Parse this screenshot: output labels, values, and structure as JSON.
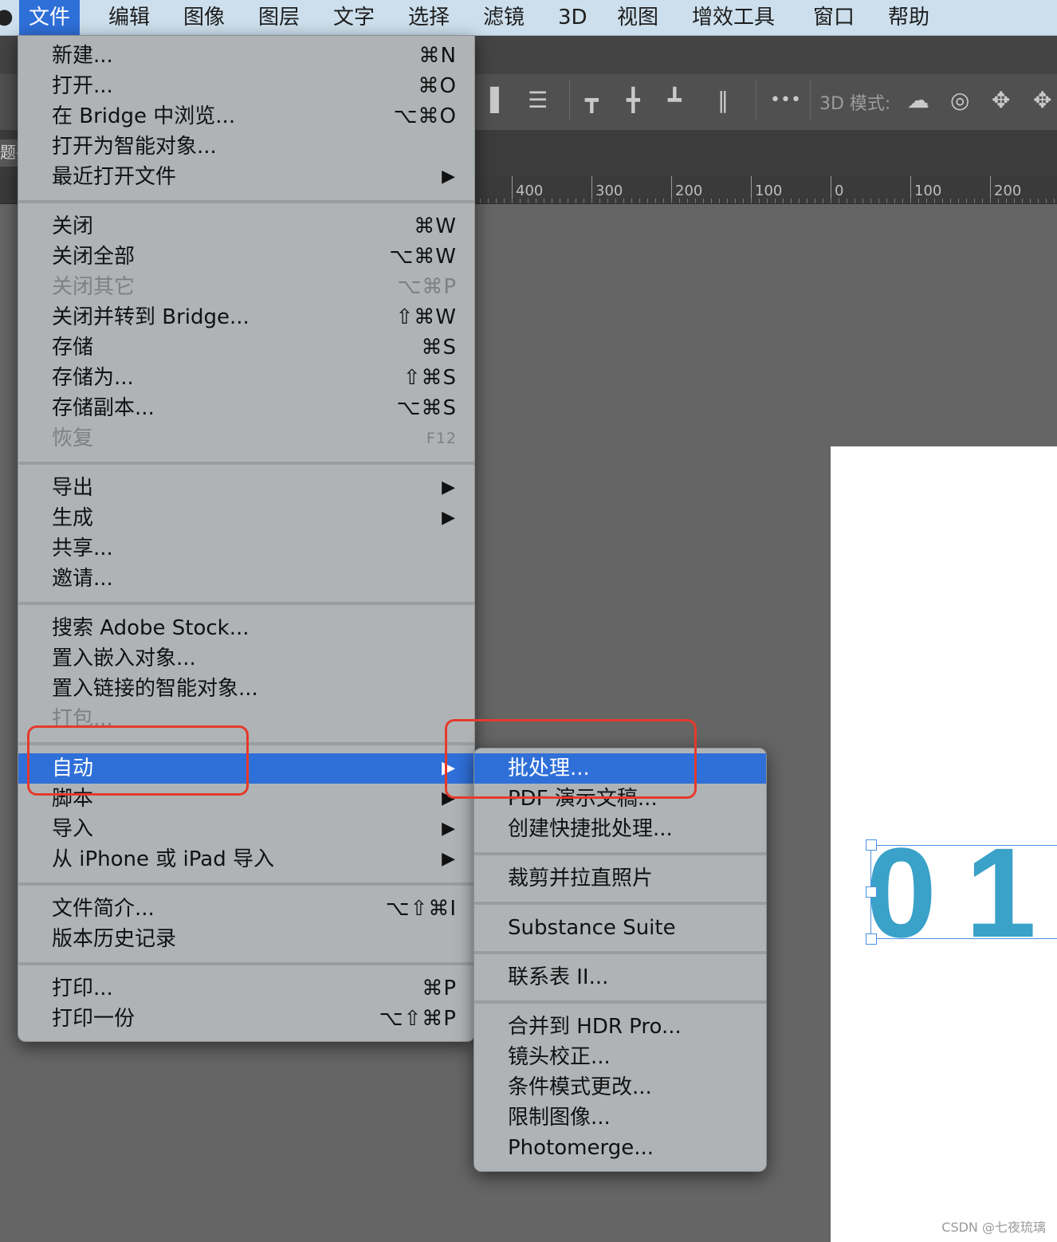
{
  "menubar": {
    "items": [
      "文件",
      "编辑",
      "图像",
      "图层",
      "文字",
      "选择",
      "滤镜",
      "3D",
      "视图",
      "增效工具",
      "窗口",
      "帮助"
    ],
    "active_index": 0
  },
  "toolbar": {
    "more_label": "•••",
    "mode3d_label": "3D 模式:"
  },
  "tab_fragment": "题–",
  "ruler": {
    "labels": [
      "400",
      "300",
      "200",
      "100",
      "0",
      "100",
      "200"
    ]
  },
  "canvas": {
    "big_text": "01"
  },
  "file_menu": {
    "groups": [
      [
        {
          "label": "新建...",
          "shortcut": "⌘N"
        },
        {
          "label": "打开...",
          "shortcut": "⌘O"
        },
        {
          "label": "在 Bridge 中浏览...",
          "shortcut": "⌥⌘O"
        },
        {
          "label": "打开为智能对象...",
          "shortcut": ""
        },
        {
          "label": "最近打开文件",
          "submenu": true
        }
      ],
      [
        {
          "label": "关闭",
          "shortcut": "⌘W"
        },
        {
          "label": "关闭全部",
          "shortcut": "⌥⌘W"
        },
        {
          "label": "关闭其它",
          "shortcut": "⌥⌘P",
          "disabled": true
        },
        {
          "label": "关闭并转到 Bridge...",
          "shortcut": "⇧⌘W"
        },
        {
          "label": "存储",
          "shortcut": "⌘S"
        },
        {
          "label": "存储为...",
          "shortcut": "⇧⌘S"
        },
        {
          "label": "存储副本...",
          "shortcut": "⌥⌘S"
        },
        {
          "label": "恢复",
          "shortcut": "F12",
          "disabled": true,
          "small": true
        }
      ],
      [
        {
          "label": "导出",
          "submenu": true
        },
        {
          "label": "生成",
          "submenu": true
        },
        {
          "label": "共享...",
          "shortcut": ""
        },
        {
          "label": "邀请...",
          "shortcut": ""
        }
      ],
      [
        {
          "label": "搜索 Adobe Stock...",
          "shortcut": ""
        },
        {
          "label": "置入嵌入对象...",
          "shortcut": ""
        },
        {
          "label": "置入链接的智能对象...",
          "shortcut": ""
        },
        {
          "label": "打包...",
          "shortcut": "",
          "disabled": true
        }
      ],
      [
        {
          "label": "自动",
          "submenu": true,
          "highlighted": true
        },
        {
          "label": "脚本",
          "submenu": true
        },
        {
          "label": "导入",
          "submenu": true
        },
        {
          "label": "从 iPhone 或 iPad 导入",
          "submenu": true
        }
      ],
      [
        {
          "label": "文件简介...",
          "shortcut": "⌥⇧⌘I"
        },
        {
          "label": "版本历史记录",
          "shortcut": ""
        }
      ],
      [
        {
          "label": "打印...",
          "shortcut": "⌘P"
        },
        {
          "label": "打印一份",
          "shortcut": "⌥⇧⌘P"
        }
      ]
    ]
  },
  "submenu_auto": {
    "groups": [
      [
        {
          "label": "批处理...",
          "highlighted": true
        },
        {
          "label": "PDF 演示文稿..."
        },
        {
          "label": "创建快捷批处理..."
        }
      ],
      [
        {
          "label": "裁剪并拉直照片"
        }
      ],
      [
        {
          "label": "Substance Suite"
        }
      ],
      [
        {
          "label": "联系表 II..."
        }
      ],
      [
        {
          "label": "合并到 HDR Pro..."
        },
        {
          "label": "镜头校正..."
        },
        {
          "label": "条件模式更改..."
        },
        {
          "label": "限制图像..."
        },
        {
          "label": "Photomerge..."
        }
      ]
    ]
  },
  "colors": {
    "accent": "#2f6fd8",
    "annotation": "#e53a2b",
    "number_text": "#3aa1c9"
  },
  "watermark": "CSDN @七夜琉璃"
}
